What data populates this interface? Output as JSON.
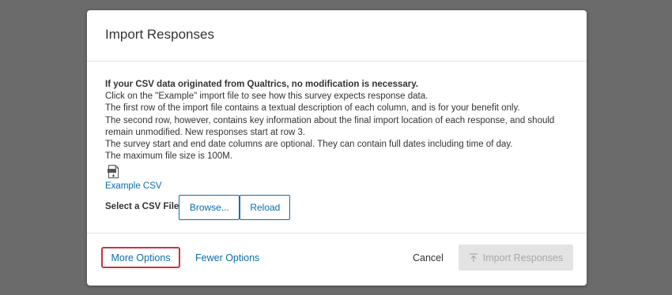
{
  "dialog": {
    "title": "Import Responses"
  },
  "body": {
    "intro_bold": "If your CSV data originated from Qualtrics, no modification is necessary.",
    "lines": [
      "Click on the \"Example\" import file to see how this survey expects response data.",
      "The first row of the import file contains a textual description of each column, and is for your benefit only.",
      "The second row, however, contains key information about the final import location of each response, and should remain unmodified. New responses start at row 3.",
      "The survey start and end date columns are optional. They can contain full dates including time of day.",
      "The maximum file size is 100M."
    ],
    "example_icon": "csv-file-icon",
    "example_link": "Example CSV",
    "file_label": "Select a CSV File",
    "browse_label": "Browse...",
    "reload_label": "Reload"
  },
  "footer": {
    "more_options": "More Options",
    "fewer_options": "Fewer Options",
    "cancel": "Cancel",
    "import_label": "Import Responses",
    "import_icon": "upload-arrow-icon",
    "import_disabled": true
  },
  "colors": {
    "accent": "#0b6ea8",
    "highlight_border": "#c8343e",
    "backdrop": "#6b6b6b",
    "disabled_bg": "#e3e3e3",
    "disabled_text": "#a8a8a8"
  }
}
